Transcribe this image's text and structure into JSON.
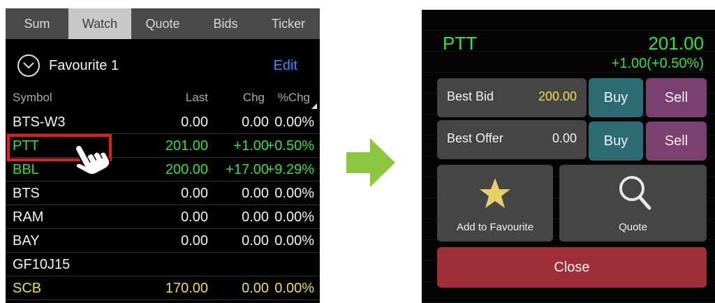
{
  "left": {
    "tabs": [
      "Sum",
      "Watch",
      "Quote",
      "Bids",
      "Ticker"
    ],
    "watchlist": {
      "name": "Favourite 1",
      "edit_label": "Edit"
    },
    "columns": {
      "symbol": "Symbol",
      "last": "Last",
      "chg": "Chg",
      "pct": "%Chg"
    },
    "rows": [
      {
        "symbol": "BTS-W3",
        "last": "0.00",
        "chg": "0.00",
        "pct": "0.00%",
        "color": "#f2f2f2"
      },
      {
        "symbol": "PTT",
        "last": "201.00",
        "chg": "+1.00",
        "pct": "+0.50%",
        "color": "#34e23d"
      },
      {
        "symbol": "BBL",
        "last": "200.00",
        "chg": "+17.00",
        "pct": "+9.29%",
        "color": "#34e23d"
      },
      {
        "symbol": "BTS",
        "last": "0.00",
        "chg": "0.00",
        "pct": "0.00%",
        "color": "#f2f2f2"
      },
      {
        "symbol": "RAM",
        "last": "0.00",
        "chg": "0.00",
        "pct": "0.00%",
        "color": "#f2f2f2"
      },
      {
        "symbol": "BAY",
        "last": "0.00",
        "chg": "0.00",
        "pct": "0.00%",
        "color": "#f2f2f2"
      },
      {
        "symbol": "GF10J15",
        "last": "",
        "chg": "",
        "pct": "",
        "color": "#f2f2f2"
      },
      {
        "symbol": "SCB",
        "last": "170.00",
        "chg": "0.00",
        "pct": "0.00%",
        "color": "#f4dd46"
      }
    ]
  },
  "popup": {
    "symbol": "PTT",
    "price": "201.00",
    "change": "+1.00(+0.50%)",
    "best_bid_label": "Best Bid",
    "best_bid_value": "200.00",
    "best_offer_label": "Best Offer",
    "best_offer_value": "0.00",
    "buy_label": "Buy",
    "sell_label": "Sell",
    "favourite_label": "Add to Favourite",
    "quote_label": "Quote",
    "close_label": "Close"
  },
  "colors": {
    "up": "#34e23d",
    "neutral": "#f2f2f2",
    "yellow": "#f4dd46",
    "buy": "#2c6a74",
    "sell": "#7c3f72",
    "close": "#9e2f39",
    "arrow": "#8dc63f",
    "highlight": "#e0201c"
  },
  "icons": [
    "chevron-down-icon",
    "sort-corner-icon",
    "tap-hand-icon",
    "right-arrow-icon",
    "star-icon",
    "magnifier-icon"
  ]
}
